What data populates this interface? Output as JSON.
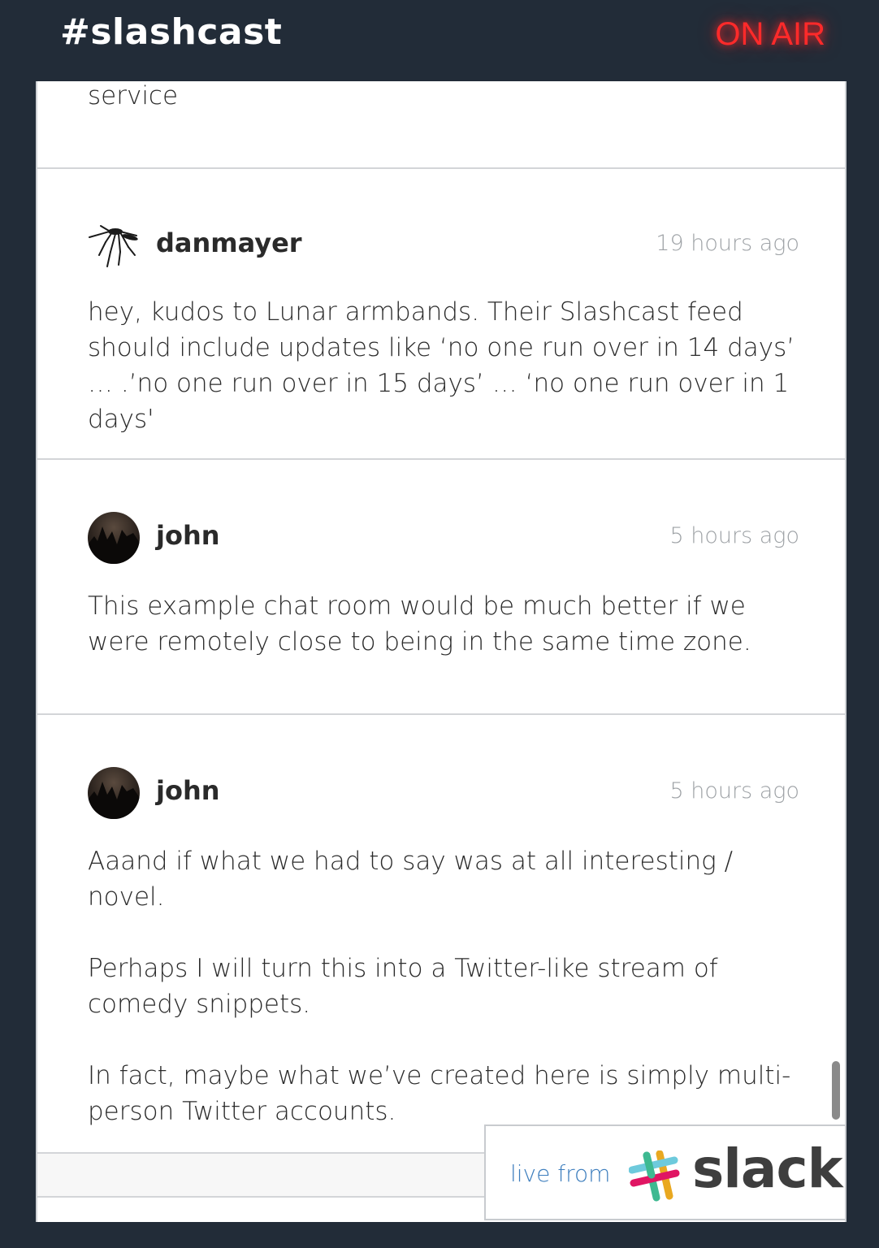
{
  "header": {
    "channel": "#slashcast",
    "status": "ON AIR",
    "status_color": "#ff2a2a"
  },
  "feed": {
    "truncated_text": "service",
    "messages": [
      {
        "user": "danmayer",
        "avatar": "mosquito-icon",
        "time": "19 hours ago",
        "paragraphs": [
          "hey, kudos to Lunar armbands. Their Slashcast feed should include updates like ‘no one run over in 14 days’ … .’no one run over in 15 days’ … ‘no one run over in 1 days'"
        ]
      },
      {
        "user": "john",
        "avatar": "photo",
        "time": "5 hours ago",
        "paragraphs": [
          "This example chat room would be much better if we were remotely close to being in the same time zone."
        ]
      },
      {
        "user": "john",
        "avatar": "photo",
        "time": "5 hours ago",
        "paragraphs": [
          "Aaand if what we had to say was at all interesting / novel.",
          "Perhaps I will turn this into a Twitter-like stream of comedy snippets.",
          "In fact, maybe what we’ve created here is simply multi-person Twitter accounts."
        ]
      }
    ]
  },
  "footer": {
    "live_from": "live from",
    "brand": "slack",
    "link_color": "#3c7dbd"
  }
}
